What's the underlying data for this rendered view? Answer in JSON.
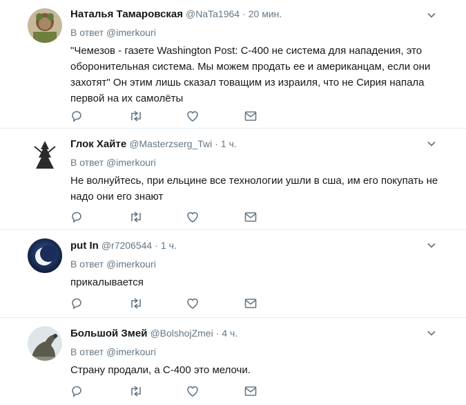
{
  "tweets": [
    {
      "name": "Наталья Тамаровская",
      "handle": "@NaTa1964",
      "time": "20 мин.",
      "reply_label": "В ответ",
      "reply_to": "@imerkouri",
      "text": "\"Чемезов - газете Washington Post: С-400 не система для нападения, это\nоборонительная система. Мы можем продать ее и американцам, если они\nзахотят\" Он этим лишь сказал товащим из израиля, что не Сирия напала\nпервой на их самолёты"
    },
    {
      "name": "Глок Хайте",
      "handle": "@Masterzserg_Twi",
      "time": "1 ч.",
      "reply_label": "В ответ",
      "reply_to": "@imerkouri",
      "text": "Не волнуйтесь, при ельцине все технологии ушли в сша, им его покупать не\nнадо они его знают"
    },
    {
      "name": "put In",
      "handle": "@r7206544",
      "time": "1 ч.",
      "reply_label": "В ответ",
      "reply_to": "@imerkouri",
      "text": "прикалывается"
    },
    {
      "name": "Большой Змей",
      "handle": "@BolshojZmei",
      "time": "4 ч.",
      "reply_label": "В ответ",
      "reply_to": "@imerkouri",
      "text": "Страну продали, а С-400 это мелочи."
    }
  ],
  "colors": {
    "text": "#14171a",
    "muted": "#657786",
    "divider": "#e6ecf0",
    "icon": "#657786"
  },
  "icons": [
    "reply-icon",
    "retweet-icon",
    "like-icon",
    "message-icon",
    "caret-down-icon"
  ]
}
